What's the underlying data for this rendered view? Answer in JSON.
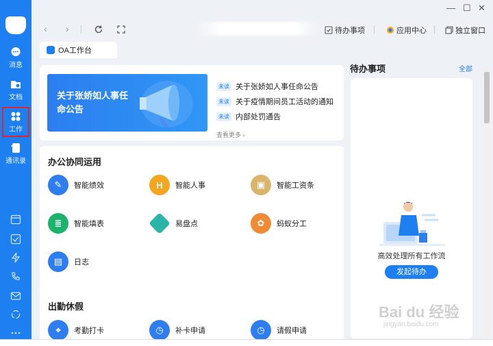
{
  "sidebar": {
    "items": [
      {
        "label": "消息"
      },
      {
        "label": "文档"
      },
      {
        "label": "工作"
      },
      {
        "label": "通讯录"
      }
    ]
  },
  "topbar": {
    "todo_label": "待办事项",
    "apps_label": "应用中心",
    "window_label": "独立窗口"
  },
  "tab": {
    "label": "OA工作台"
  },
  "announce": {
    "banner_text": "关于张娇如人事任命公告",
    "badge": "未读",
    "items": [
      "关于张娇如人事任命公告",
      "关于疫情期间员工活动的通知",
      "内部处罚通告"
    ],
    "see_more": "查看更多"
  },
  "office": {
    "title": "办公协同运用",
    "apps": [
      {
        "label": "智能绩效",
        "color": "#2f7ef0"
      },
      {
        "label": "智能人事",
        "color": "#f6a51f"
      },
      {
        "label": "智能工资条",
        "color": "#d9b46b"
      },
      {
        "label": "智能填表",
        "color": "#19b36b"
      },
      {
        "label": "易盘点",
        "color": "#2bb5a8"
      },
      {
        "label": "蚂蚁分工",
        "color": "#f08a35"
      },
      {
        "label": "日志",
        "color": "#2f7ef0"
      }
    ]
  },
  "attendance": {
    "title": "出勤休假",
    "apps": [
      {
        "label": "考勤打卡"
      },
      {
        "label": "补卡申请"
      },
      {
        "label": "请假申请"
      }
    ]
  },
  "todo": {
    "title": "待办事项",
    "all_label": "全部",
    "desc": "高效处理所有工作流",
    "button": "发起待办"
  },
  "watermark": {
    "text": "Bai du 经验",
    "sub": "jingyan.baidu.com"
  }
}
